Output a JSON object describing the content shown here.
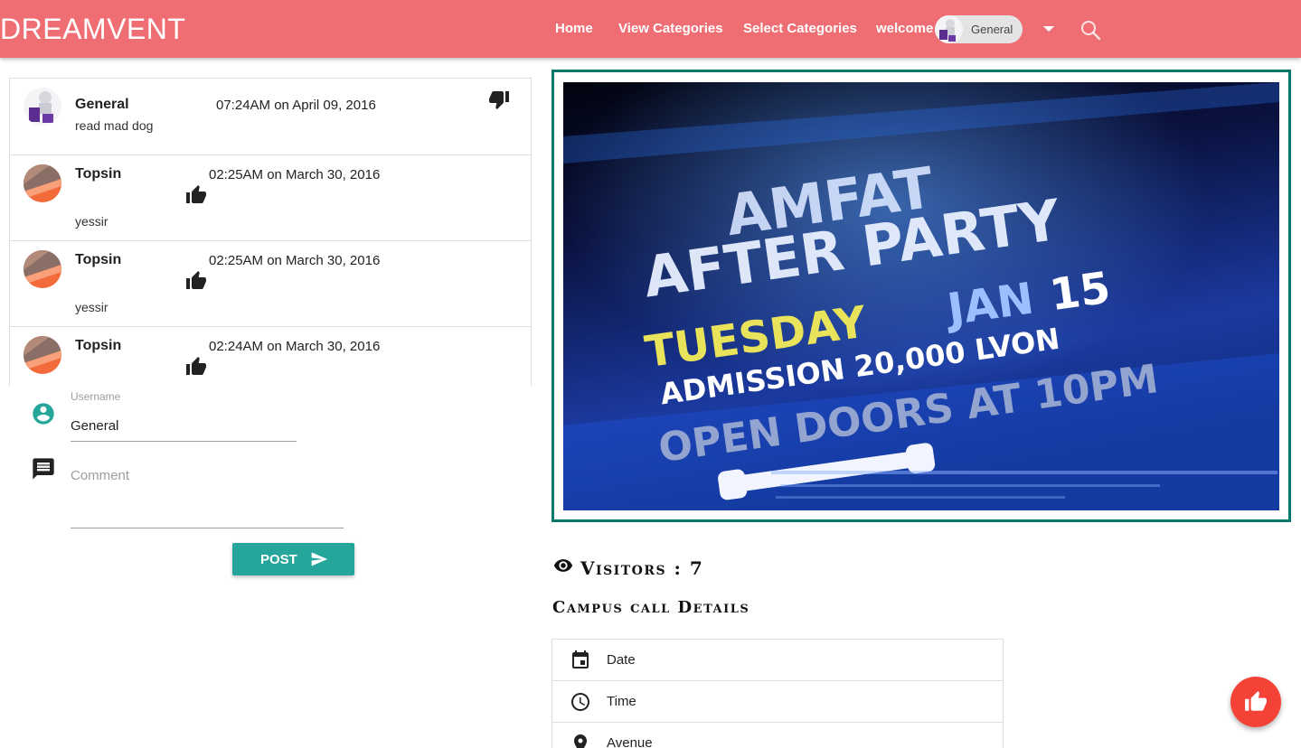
{
  "nav": {
    "brand": "DREAMVENT",
    "links": [
      "Home",
      "View Categories",
      "Select Categories"
    ],
    "welcome": "welcome",
    "user_chip": "General",
    "icons": [
      "dropdown-caret-icon",
      "search-icon"
    ]
  },
  "comments": [
    {
      "name": "General",
      "time": "07:24AM on April 09, 2016",
      "text": "read mad dog",
      "reaction_icon": "thumb-down-icon"
    },
    {
      "name": "Topsin",
      "time": "02:25AM on March 30, 2016",
      "text": "yessir",
      "reaction_icon": "thumb-up-icon"
    },
    {
      "name": "Topsin",
      "time": "02:25AM on March 30, 2016",
      "text": "yessir",
      "reaction_icon": "thumb-up-icon"
    },
    {
      "name": "Topsin",
      "time": "02:24AM on March 30, 2016",
      "text": "",
      "reaction_icon": "thumb-up-icon"
    }
  ],
  "form": {
    "username_label": "Username",
    "username_value": "General",
    "comment_placeholder": "Comment",
    "post_label": "POST"
  },
  "poster": {
    "line1": "AMFAT",
    "line2": "AFTER PARTY",
    "day": "TUESDAY",
    "month": "JAN",
    "date": "15",
    "admission": "ADMISSION 20,000 LVON",
    "doors": "OPEN DOORS AT 10PM"
  },
  "visitors": {
    "text": "Visitors : 7",
    "count": 7
  },
  "details": {
    "title": "Campus call Details",
    "items": [
      {
        "label": "Date",
        "icon": "calendar-icon"
      },
      {
        "label": "Time",
        "icon": "clock-icon"
      },
      {
        "label": "Avenue",
        "icon": "location-pin-icon"
      }
    ]
  },
  "colors": {
    "nav": "#ef6e73",
    "accent": "#26a69a",
    "frame": "#00796b",
    "fab": "#f44336"
  }
}
